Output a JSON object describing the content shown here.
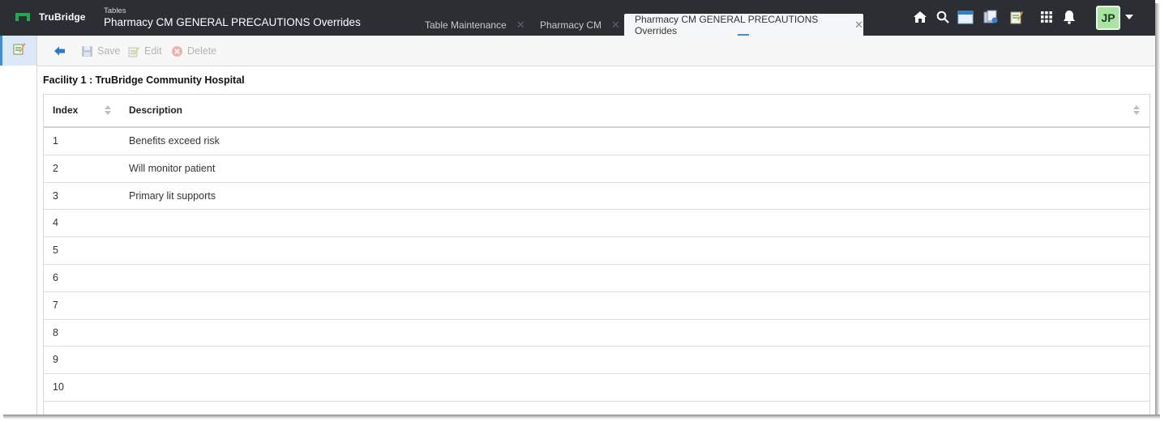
{
  "brand": {
    "name": "TruBridge",
    "accent": "#1fa34a"
  },
  "header": {
    "section": "Tables",
    "title": "Pharmacy CM GENERAL PRECAUTIONS Overrides"
  },
  "tabs": [
    {
      "label": "Table Maintenance",
      "active": false
    },
    {
      "label": "Pharmacy CM",
      "active": false
    },
    {
      "label": "Pharmacy CM GENERAL PRECAUTIONS Overrides",
      "active": true
    }
  ],
  "topbar_icons": [
    "home-icon",
    "search-icon",
    "window-icon",
    "documents-icon",
    "notes-icon",
    "apps-grid-icon",
    "bell-icon"
  ],
  "user": {
    "initials": "JP"
  },
  "toolbar": {
    "back_icon": "back-arrow-icon",
    "save_label": "Save",
    "edit_label": "Edit",
    "delete_label": "Delete"
  },
  "facility_label": "Facility 1 : TruBridge Community Hospital",
  "table": {
    "columns": [
      "Index",
      "Description"
    ],
    "rows": [
      {
        "index": "1",
        "description": "Benefits exceed risk"
      },
      {
        "index": "2",
        "description": "Will monitor patient"
      },
      {
        "index": "3",
        "description": "Primary lit supports"
      },
      {
        "index": "4",
        "description": ""
      },
      {
        "index": "5",
        "description": ""
      },
      {
        "index": "6",
        "description": ""
      },
      {
        "index": "7",
        "description": ""
      },
      {
        "index": "8",
        "description": ""
      },
      {
        "index": "9",
        "description": ""
      },
      {
        "index": "10",
        "description": ""
      }
    ]
  }
}
